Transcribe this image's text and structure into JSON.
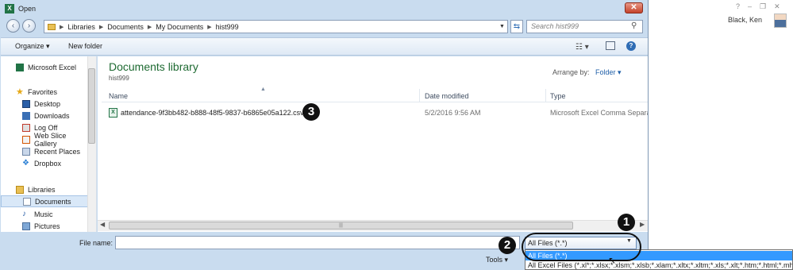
{
  "window": {
    "title": "Open",
    "app_icon": "excel-icon"
  },
  "backdrop": {
    "window_controls": [
      "?",
      "–",
      "❐",
      "✕"
    ],
    "user_name": "Black, Ken"
  },
  "address_bar": {
    "crumbs": [
      "Libraries",
      "Documents",
      "My Documents",
      "hist999"
    ]
  },
  "search": {
    "placeholder": "Search hist999"
  },
  "toolbar": {
    "organize": "Organize ▾",
    "new_folder": "New folder"
  },
  "nav": {
    "app": "Microsoft Excel",
    "favorites_header": "Favorites",
    "favorites": [
      "Desktop",
      "Downloads",
      "Log Off",
      "Web Slice Gallery",
      "Recent Places",
      "Dropbox"
    ],
    "libraries_header": "Libraries",
    "libraries": [
      "Documents",
      "Music",
      "Pictures"
    ]
  },
  "library": {
    "title": "Documents library",
    "subtitle": "hist999",
    "arrange_label": "Arrange by:",
    "arrange_value": "Folder ▾"
  },
  "columns": {
    "name": "Name",
    "date": "Date modified",
    "type": "Type"
  },
  "files": [
    {
      "name": "attendance-9f3bb482-b888-48f5-9837-b6865e05a122.csv",
      "date": "5/2/2016 9:56 AM",
      "type": "Microsoft Excel Comma Separated"
    }
  ],
  "file_name": {
    "label": "File name:",
    "value": ""
  },
  "filter": {
    "selected": "All Files (*.*)",
    "options": [
      "All Files (*.*)",
      "All Excel Files (*.xl*;*.xlsx;*.xlsm;*.xlsb;*.xlam;*.xltx;*.xltm;*.xls;*.xlt;*.htm;*.html;*.mht;*.mhtml)"
    ]
  },
  "tools": {
    "label": "Tools ▾"
  },
  "annotations": {
    "badge_1": "1",
    "badge_2": "2",
    "badge_3": "3"
  },
  "colors": {
    "selection": "#3399ff",
    "chrome": "#c9dcef",
    "library_title": "#1e6a32",
    "close": "#c4422a"
  }
}
